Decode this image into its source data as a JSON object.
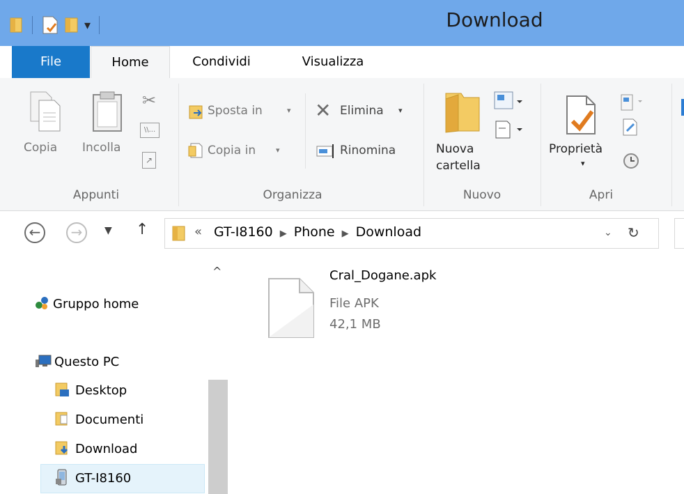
{
  "window": {
    "title": "Download"
  },
  "tabs": {
    "file": "File",
    "home": "Home",
    "share": "Condividi",
    "view": "Visualizza"
  },
  "ribbon": {
    "clipboard": {
      "copy": "Copia",
      "paste": "Incolla",
      "group": "Appunti"
    },
    "organize": {
      "move_to": "Sposta in",
      "copy_to": "Copia in",
      "delete": "Elimina",
      "rename": "Rinomina",
      "group": "Organizza"
    },
    "new": {
      "new_folder_line1": "Nuova",
      "new_folder_line2": "cartella",
      "group": "Nuovo"
    },
    "open": {
      "properties": "Proprietà",
      "group": "Apri"
    }
  },
  "address": {
    "overflow": "«",
    "parts": [
      "GT-I8160",
      "Phone",
      "Download"
    ]
  },
  "nav": {
    "homegroup": "Gruppo home",
    "this_pc": "Questo PC",
    "desktop": "Desktop",
    "documents": "Documenti",
    "downloads": "Download",
    "device": "GT-I8160"
  },
  "file": {
    "name": "Cral_Dogane.apk",
    "type": "File APK",
    "size": "42,1 MB"
  },
  "colors": {
    "titlebar": "#6fa8ea",
    "file_tab": "#1979ca",
    "ribbon_bg": "#f5f6f7",
    "folder": "#e8b84a"
  }
}
